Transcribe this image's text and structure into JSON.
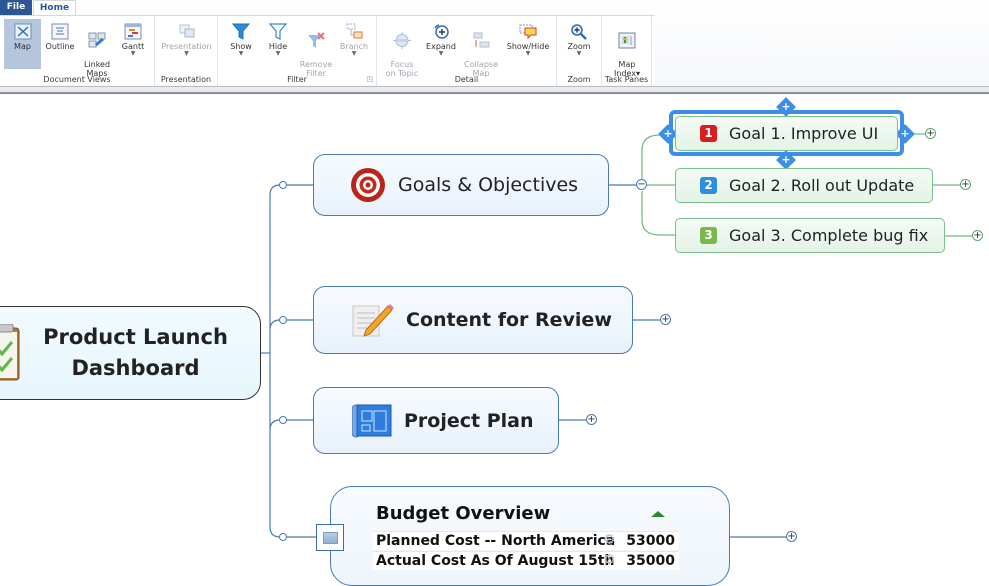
{
  "ribbon": {
    "tabs": [
      {
        "label": "File"
      },
      {
        "label": "Home",
        "active": true
      }
    ],
    "groups": [
      {
        "label": "Document Views",
        "buttons": [
          {
            "label": "Map",
            "icon": "map-view-icon",
            "active": true
          },
          {
            "label": "Outline",
            "icon": "outline-view-icon"
          },
          {
            "label": "Linked\nMaps",
            "icon": "linked-maps-icon"
          },
          {
            "label": "Gantt",
            "icon": "gantt-icon",
            "dropdown": true
          }
        ]
      },
      {
        "label": "Presentation",
        "buttons": [
          {
            "label": "Presentation",
            "icon": "presentation-icon",
            "dropdown": true,
            "disabled": true
          }
        ]
      },
      {
        "label": "Filter",
        "buttons": [
          {
            "label": "Show",
            "icon": "filter-show-icon",
            "dropdown": true
          },
          {
            "label": "Hide",
            "icon": "filter-hide-icon",
            "dropdown": true
          },
          {
            "label": "Remove\nFilter",
            "icon": "remove-filter-icon",
            "disabled": true
          },
          {
            "label": "Branch",
            "icon": "branch-icon",
            "dropdown": true,
            "disabled": true
          }
        ]
      },
      {
        "label": "Detail",
        "buttons": [
          {
            "label": "Focus\non Topic",
            "icon": "focus-topic-icon",
            "disabled": true
          },
          {
            "label": "Expand",
            "icon": "expand-icon",
            "dropdown": true
          },
          {
            "label": "Collapse\nMap",
            "icon": "collapse-map-icon",
            "disabled": true
          },
          {
            "label": "Show/Hide",
            "icon": "show-hide-icon",
            "dropdown": true
          }
        ]
      },
      {
        "label": "Zoom",
        "buttons": [
          {
            "label": "Zoom",
            "icon": "zoom-icon",
            "dropdown": true
          }
        ]
      },
      {
        "label": "Task Panes",
        "buttons": [
          {
            "label": "Map\nIndex▾",
            "icon": "map-index-icon"
          }
        ]
      }
    ]
  },
  "map": {
    "central_topic": {
      "label": "Product Launch Dashboard",
      "icon": "clipboard-checklist-icon"
    },
    "main_topics": [
      {
        "label": "Goals & Objectives",
        "icon": "target-icon",
        "expanded": true
      },
      {
        "label": "Content for Review",
        "icon": "document-pencil-icon",
        "expanded": false
      },
      {
        "label": "Project Plan",
        "icon": "blueprint-icon",
        "expanded": false
      }
    ],
    "subtopics": [
      {
        "number": "1",
        "label": "Goal 1. Improve UI",
        "badge_color": "#d91e1e",
        "selected": true
      },
      {
        "number": "2",
        "label": "Goal 2. Roll out Update",
        "badge_color": "#2a8fe0",
        "selected": false
      },
      {
        "number": "3",
        "label": "Goal 3. Complete bug fix",
        "badge_color": "#79b84a",
        "selected": false
      }
    ],
    "budget": {
      "title": "Budget Overview",
      "rows": [
        {
          "label": "Planned Cost -- North America",
          "value": "53000"
        },
        {
          "label": "Actual Cost As Of August 15th",
          "value": "35000"
        }
      ]
    }
  }
}
